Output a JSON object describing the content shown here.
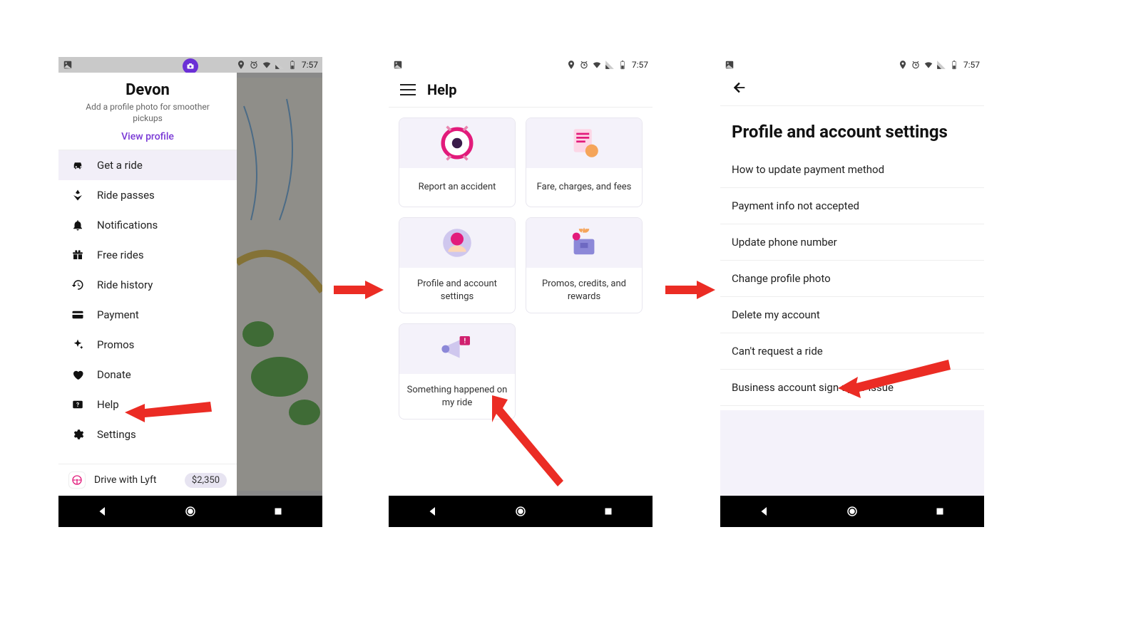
{
  "status": {
    "time": "7:57"
  },
  "screen1": {
    "user_name": "Devon",
    "user_sub": "Add a profile photo for smoother pickups",
    "view_profile": "View profile",
    "menu": [
      {
        "label": "Get a ride",
        "selected": true
      },
      {
        "label": "Ride passes",
        "selected": false
      },
      {
        "label": "Notifications",
        "selected": false
      },
      {
        "label": "Free rides",
        "selected": false
      },
      {
        "label": "Ride history",
        "selected": false
      },
      {
        "label": "Payment",
        "selected": false
      },
      {
        "label": "Promos",
        "selected": false
      },
      {
        "label": "Donate",
        "selected": false
      },
      {
        "label": "Help",
        "selected": false
      },
      {
        "label": "Settings",
        "selected": false
      }
    ],
    "drive_label": "Drive with Lyft",
    "drive_price": "$2,350"
  },
  "screen2": {
    "title": "Help",
    "cards": [
      {
        "label": "Report an accident"
      },
      {
        "label": "Fare, charges, and fees"
      },
      {
        "label": "Profile and account settings"
      },
      {
        "label": "Promos, credits, and rewards"
      },
      {
        "label": "Something happened on my ride"
      }
    ]
  },
  "screen3": {
    "title": "Profile and account settings",
    "items": [
      "How to update payment method",
      "Payment info not accepted",
      "Update phone number",
      "Change profile photo",
      "Delete my account",
      "Can't request a ride",
      "Business account sign up or issue"
    ]
  }
}
